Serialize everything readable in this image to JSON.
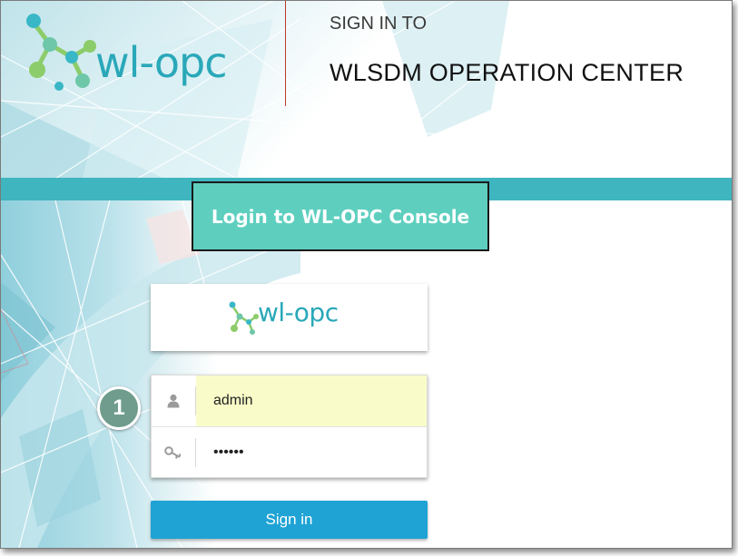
{
  "header": {
    "logo_text": "wl-opc",
    "signin_to": "SIGN IN TO",
    "title": "WLSDM OPERATION CENTER"
  },
  "banner": {
    "label": "Login to WL-OPC Console"
  },
  "login_card": {
    "logo_text": "wl-opc"
  },
  "step_badge": "1",
  "form": {
    "username_value": "admin",
    "password_value": "••••••",
    "username_icon": "user-icon",
    "password_icon": "key-icon"
  },
  "signin_button": {
    "label": "Sign in"
  },
  "colors": {
    "brand_teal": "#2aa8b9",
    "band": "#3fb5bf",
    "banner": "#5ecfbf",
    "button": "#1fa3d4",
    "autofill": "#f9fcc8",
    "badge": "#6f9c8c",
    "divider": "#c0392b"
  }
}
